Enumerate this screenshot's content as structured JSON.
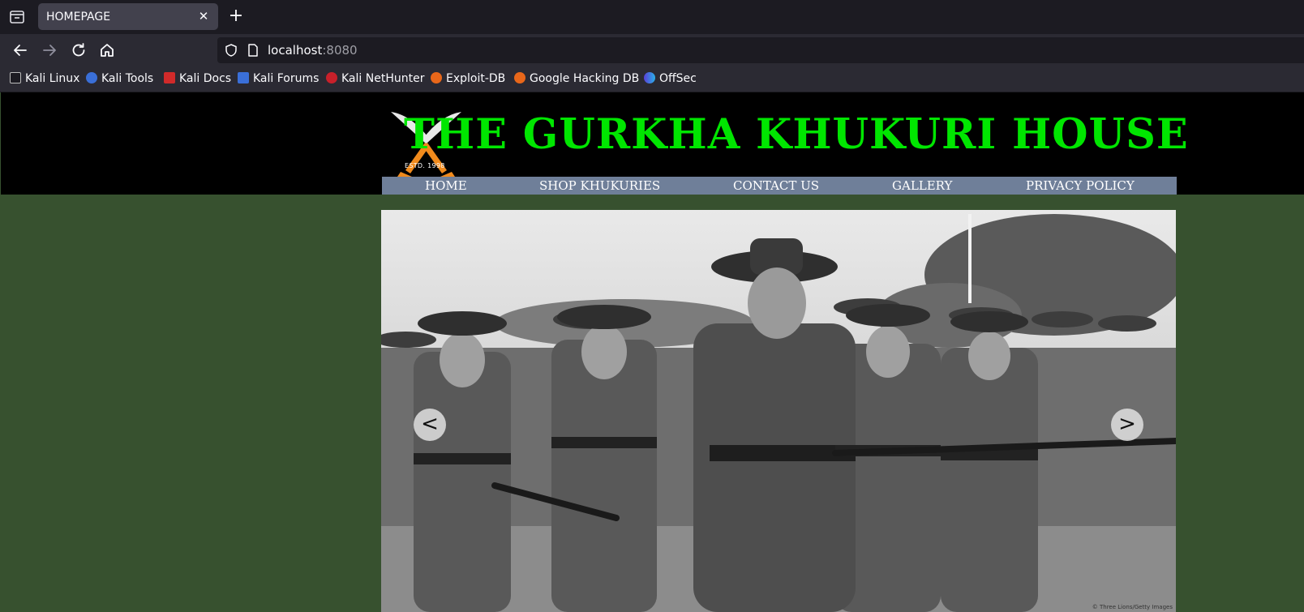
{
  "browser": {
    "tab_title": "HOMEPAGE",
    "url_host": "localhost",
    "url_port": ":8080",
    "bookmarks": [
      {
        "label": "Kali Linux",
        "icon": "kali-dragon-icon"
      },
      {
        "label": "Kali Tools",
        "icon": "kali-tools-icon"
      },
      {
        "label": "Kali Docs",
        "icon": "kali-docs-icon"
      },
      {
        "label": "Kali Forums",
        "icon": "kali-forums-icon"
      },
      {
        "label": "Kali NetHunter",
        "icon": "nethunter-icon"
      },
      {
        "label": "Exploit-DB",
        "icon": "exploit-db-icon"
      },
      {
        "label": "Google Hacking DB",
        "icon": "ghdb-icon"
      },
      {
        "label": "OffSec",
        "icon": "offsec-icon"
      }
    ]
  },
  "site": {
    "title": "THE GURKHA KHUKURI HOUSE",
    "logo_estd": "ESTD. 1998",
    "menu": [
      "HOME",
      "SHOP KHUKURIES",
      "CONTACT US",
      "GALLERY",
      "PRIVACY POLICY"
    ],
    "slider": {
      "prev_label": "<",
      "next_label": ">",
      "credit": "© Three Lions/Getty Images"
    }
  },
  "colors": {
    "page_bg": "#37512f",
    "title_green": "#00e600",
    "menu_bg": "#6f7f99"
  }
}
